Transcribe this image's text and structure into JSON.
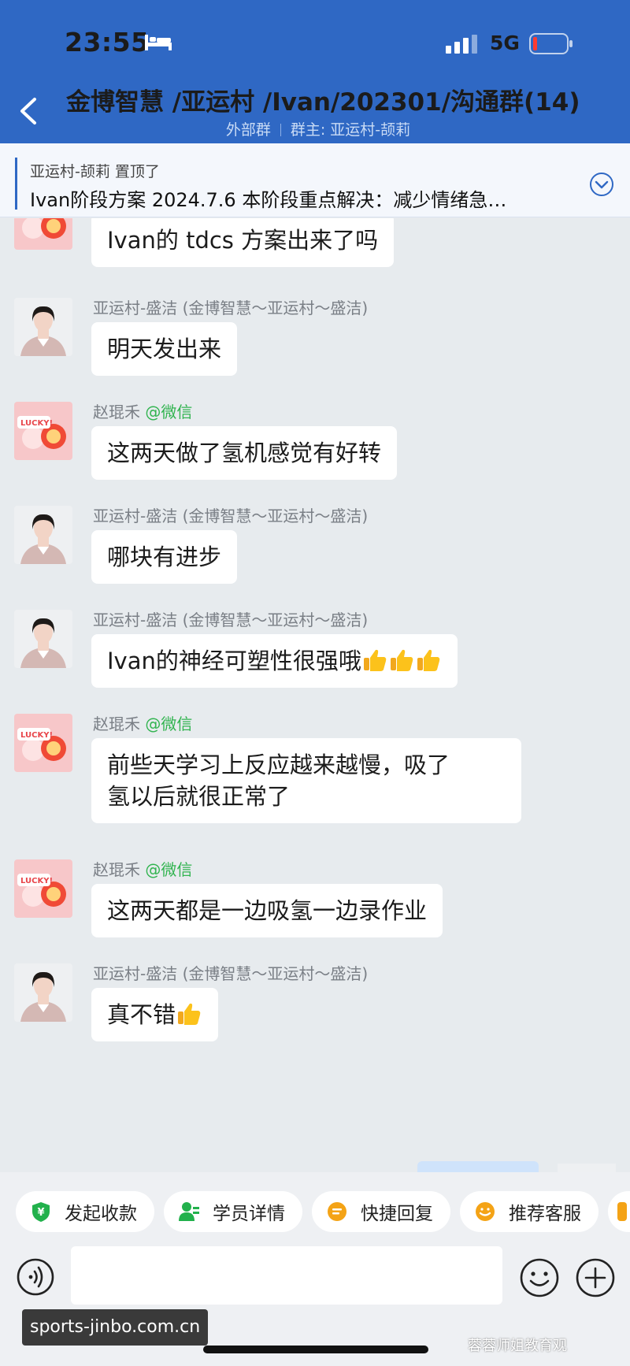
{
  "status_bar": {
    "time": "23:55",
    "network": "5G"
  },
  "header": {
    "title": "金博智慧 /亚运村 /Ivan/202301/沟通群(14)",
    "group_type": "外部群",
    "owner": "群主: 亚运村-颉莉"
  },
  "pinned": {
    "meta": "亚运村-颉莉 置顶了",
    "text": "Ivan阶段方案 2024.7.6 本阶段重点解决：减少情绪急…"
  },
  "messages": [
    {
      "sender": "",
      "wechat": "",
      "text": "Ivan的 tdcs 方案出来了吗"
    },
    {
      "sender": "亚运村-盛洁 (金博智慧～亚运村～盛洁)",
      "wechat": "",
      "text": "明天发出来"
    },
    {
      "sender": "赵琨禾",
      "wechat": "@微信",
      "text": "这两天做了氢机感觉有好转"
    },
    {
      "sender": "亚运村-盛洁 (金博智慧～亚运村～盛洁)",
      "wechat": "",
      "text": "哪块有进步"
    },
    {
      "sender": "亚运村-盛洁 (金博智慧～亚运村～盛洁)",
      "wechat": "",
      "text": "Ivan的神经可塑性很强哦"
    },
    {
      "sender": "赵琨禾",
      "wechat": "@微信",
      "text_line1": "前些天学习上反应越来越慢，吸了",
      "text_line2": "氢以后就很正常了"
    },
    {
      "sender": "赵琨禾",
      "wechat": "@微信",
      "text": "这两天都是一边吸氢一边录作业"
    },
    {
      "sender": "亚运村-盛洁 (金博智慧～亚运村～盛洁)",
      "wechat": "",
      "text": "真不错"
    }
  ],
  "quick_actions": [
    "发起收款",
    "学员详情",
    "快捷回复",
    "推荐客服"
  ],
  "watermarks": {
    "left": "sports-jinbo.com.cn",
    "right": "蓉蓉师姐教育观"
  },
  "icons": [
    "bed-icon",
    "signal-icon",
    "battery-icon",
    "back-arrow-icon",
    "chevron-down-icon",
    "thumbs-up-emoji",
    "payment-icon",
    "student-icon",
    "quick-reply-icon",
    "service-icon",
    "voice-icon",
    "emoji-icon",
    "plus-icon"
  ],
  "colors": {
    "header": "#2f68c4",
    "background": "#e7ebee",
    "wechat_green": "#32b450"
  }
}
